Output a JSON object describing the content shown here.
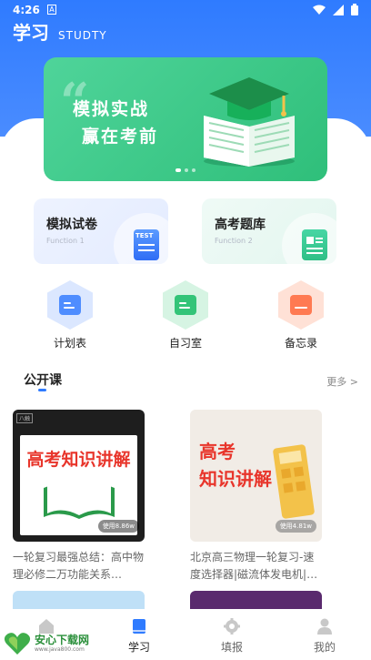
{
  "status_bar": {
    "time": "4:26",
    "notification_icon": "A"
  },
  "header": {
    "title": "学习",
    "subtitle": "STUDTY"
  },
  "banner": {
    "line1": "模拟实战",
    "line2": "赢在考前",
    "art_icon": "graduation-book-icon",
    "pages": 3,
    "active_page": 1
  },
  "function_cards": [
    {
      "title": "模拟试卷",
      "subtitle": "Function 1",
      "icon": "test-paper-icon",
      "icon_label": "TEST"
    },
    {
      "title": "高考题库",
      "subtitle": "Function 2",
      "icon": "question-bank-icon"
    }
  ],
  "tools": [
    {
      "label": "计划表",
      "icon": "planner-icon",
      "color": "#4f8dff"
    },
    {
      "label": "自习室",
      "icon": "study-room-icon",
      "color": "#33c478"
    },
    {
      "label": "备忘录",
      "icon": "memo-icon",
      "color": "#ff7a52"
    }
  ],
  "section": {
    "title": "公开课",
    "more": "更多 >"
  },
  "courses": [
    {
      "thumb_text": "高考知识讲解",
      "views": "使用8.86w",
      "description": "一轮复习最强总结：高中物理必修二万功能关系…"
    },
    {
      "thumb_text_line1": "高考",
      "thumb_text_line2": "知识讲解",
      "views": "使用4.81w",
      "description": "北京高三物理一轮复习-速度选择器|磁流体发电机|…"
    }
  ],
  "tabbar": [
    {
      "label": "",
      "icon": "home-icon",
      "active": false
    },
    {
      "label": "学习",
      "icon": "book-icon",
      "active": true
    },
    {
      "label": "填报",
      "icon": "gear-icon",
      "active": false
    },
    {
      "label": "我的",
      "icon": "person-icon",
      "active": false
    }
  ],
  "watermark": {
    "name": "安心下载网",
    "url": "www.java800.com"
  }
}
